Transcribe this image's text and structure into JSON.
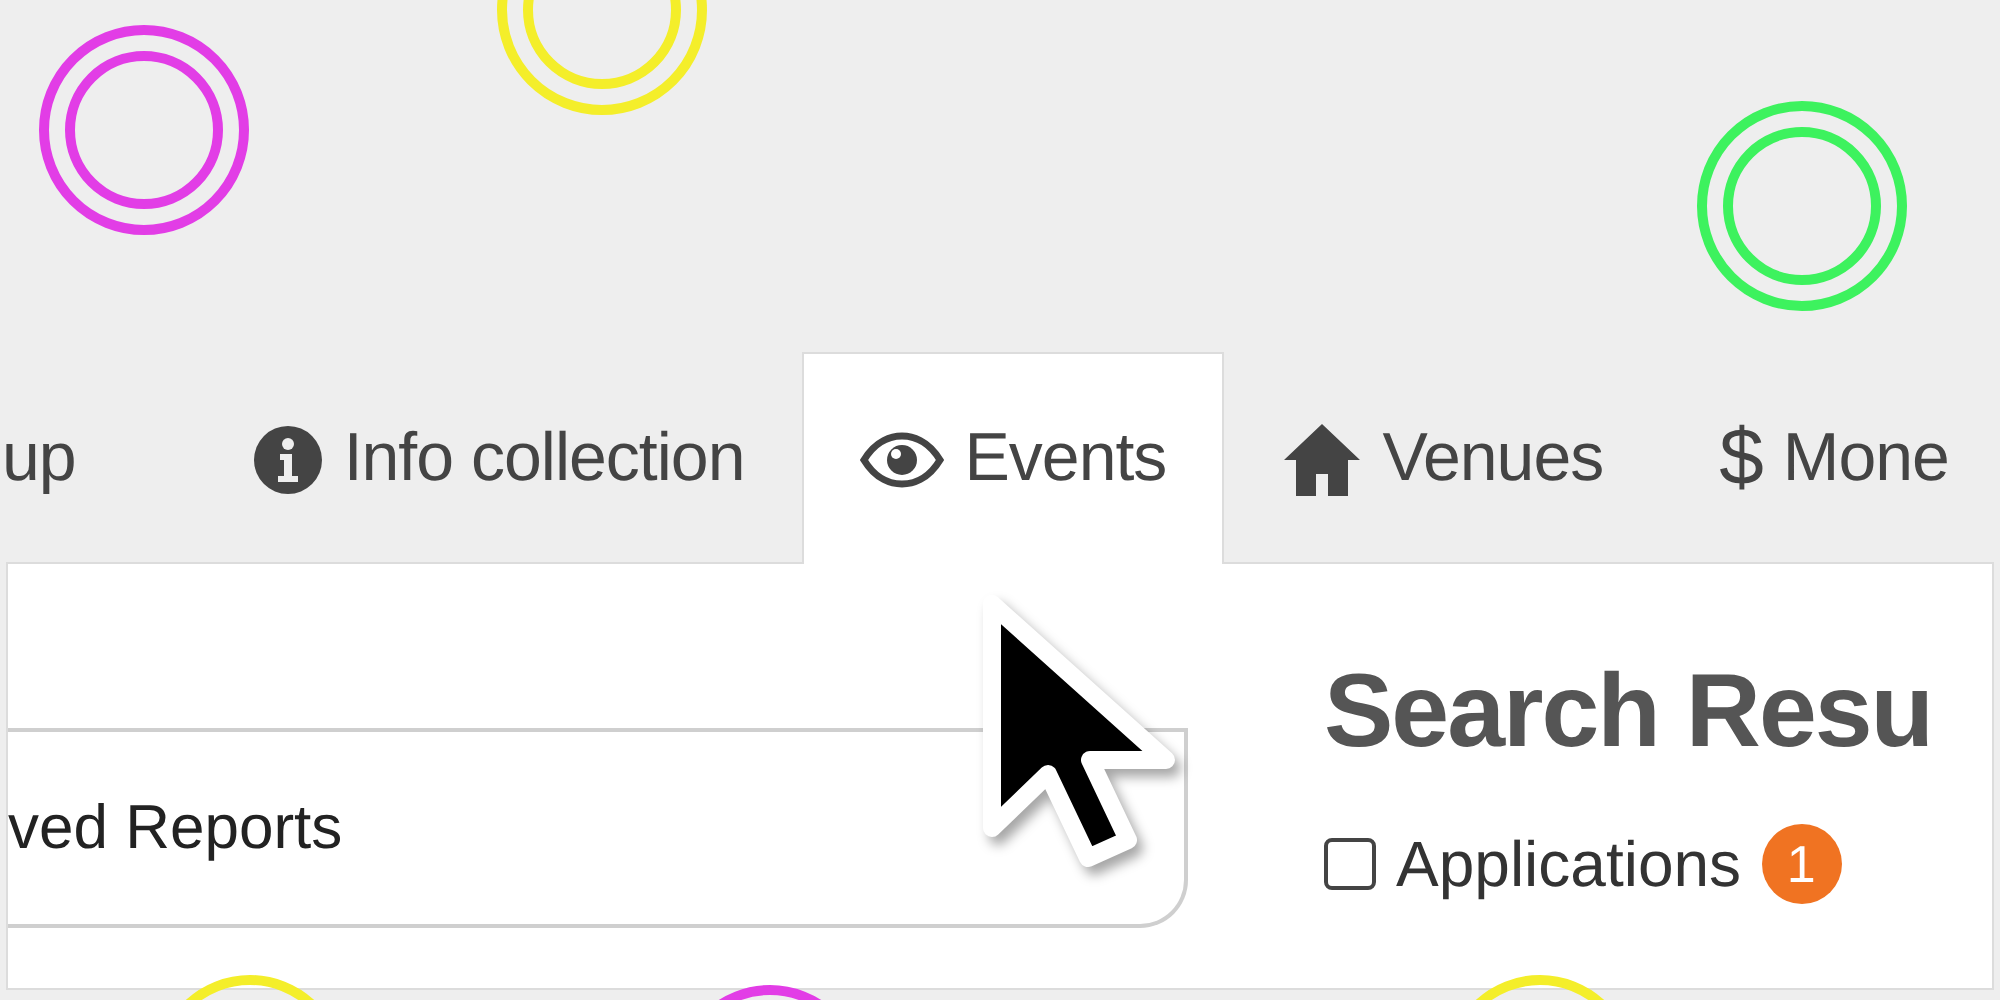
{
  "rings": [
    {
      "color": "#e23de6"
    },
    {
      "color": "#f4ee2a"
    },
    {
      "color": "#3df25e"
    },
    {
      "color": "#f4ee2a"
    },
    {
      "color": "#e23de6"
    },
    {
      "color": "#f4ee2a"
    }
  ],
  "tabs": [
    {
      "kind": "text",
      "label": "up",
      "selected": false
    },
    {
      "kind": "info",
      "label": "Info collection",
      "selected": false
    },
    {
      "kind": "eye",
      "label": "Events",
      "selected": true
    },
    {
      "kind": "home",
      "label": "Venues",
      "selected": false
    },
    {
      "kind": "symbol",
      "symbol": "$",
      "label": "Mone",
      "selected": false
    }
  ],
  "sidebar": {
    "items": [
      {
        "label": "ved Reports"
      }
    ]
  },
  "results": {
    "title": "Search Resu",
    "filters": [
      {
        "label": "Applications",
        "checked": false,
        "count": "1"
      }
    ]
  }
}
